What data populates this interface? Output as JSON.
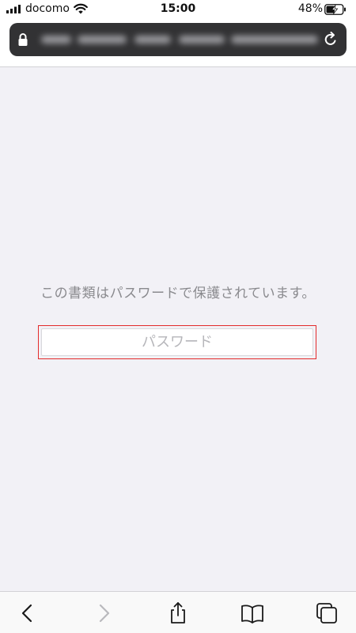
{
  "status_bar": {
    "carrier": "docomo",
    "time": "15:00",
    "battery": "48%",
    "signal_icon": "signal-bars-icon",
    "wifi_icon": "wifi-icon",
    "battery_icon": "battery-charging-icon"
  },
  "address_bar": {
    "url": "",
    "lock_icon": "lock-icon",
    "reload_icon": "reload-icon"
  },
  "content": {
    "message": "この書類はパスワードで保護されています。",
    "password_placeholder": "パスワード",
    "password_value": ""
  },
  "toolbar": {
    "back_icon": "back-icon",
    "forward_icon": "forward-icon",
    "share_icon": "share-icon",
    "bookmarks_icon": "bookmarks-icon",
    "tabs_icon": "tabs-icon"
  },
  "colors": {
    "background": "#f2f1f6",
    "address_bar": "#323234",
    "highlight_frame": "#e32b2b",
    "message_text": "#8a8a8e"
  }
}
